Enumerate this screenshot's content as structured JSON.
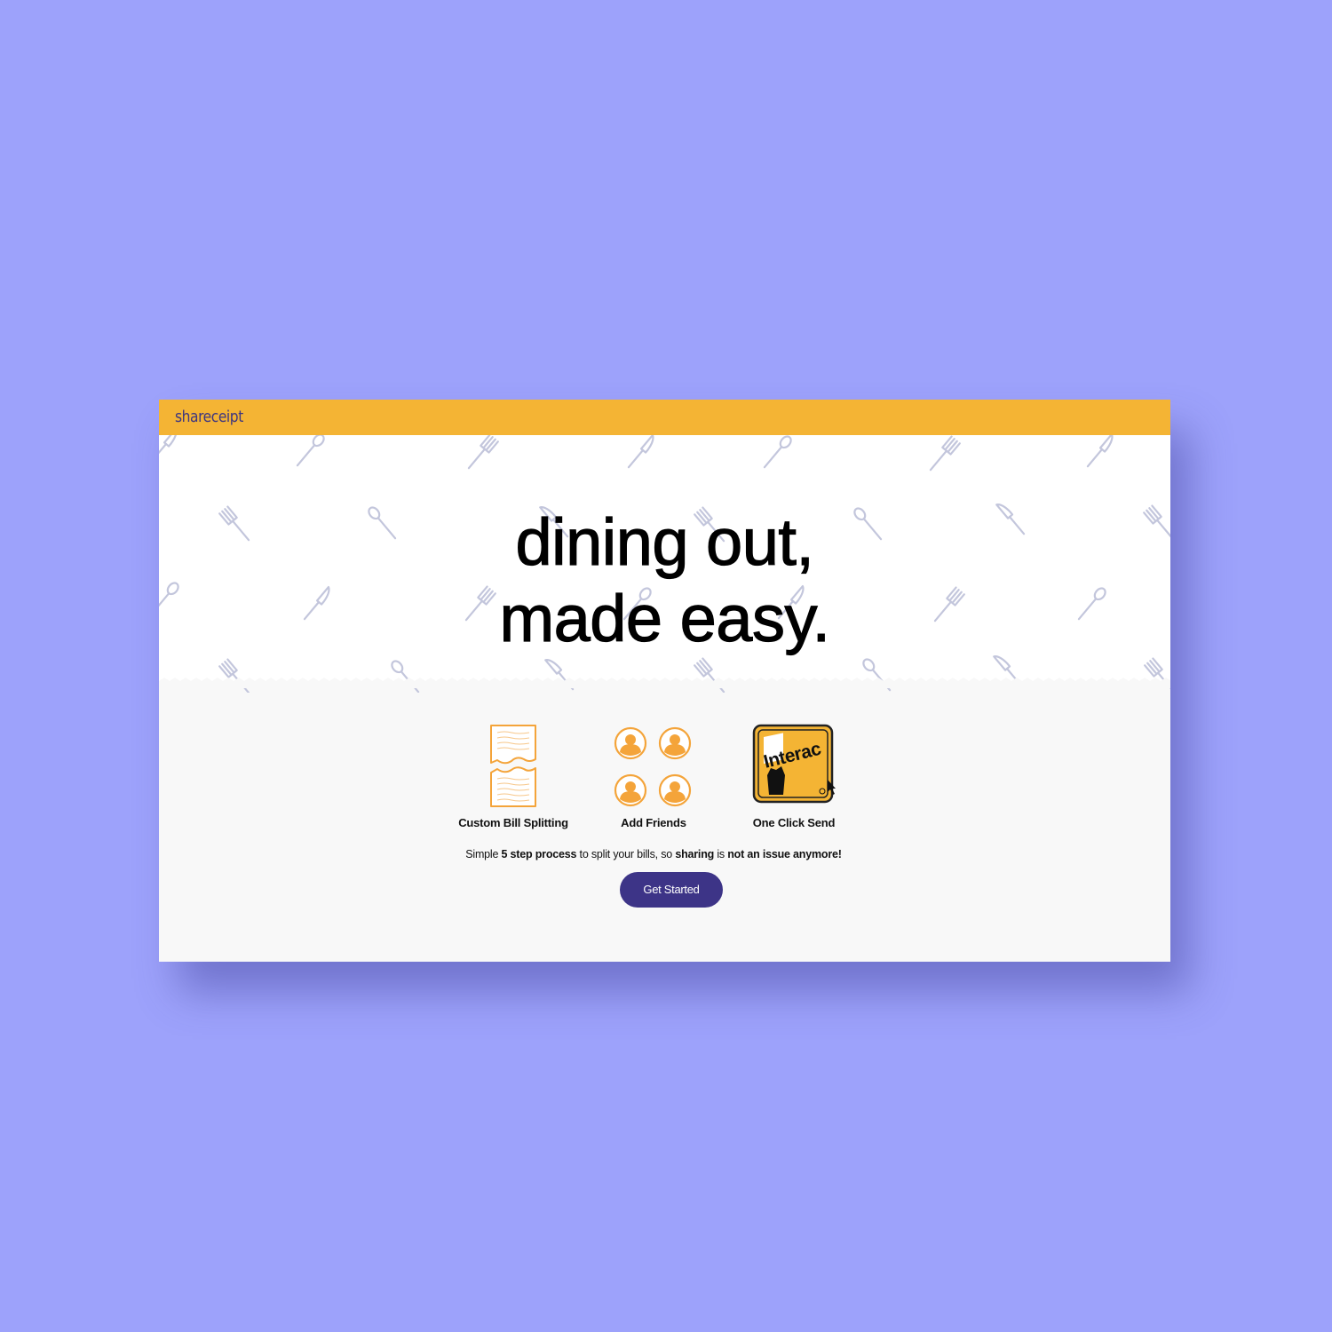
{
  "app": {
    "brand": "shareceipt",
    "colors": {
      "background": "#9da2fb",
      "header": "#f4b434",
      "accent": "#3d3487",
      "utensil": "#c3c6dc",
      "icon_orange": "#f4a43a"
    }
  },
  "hero": {
    "headline_line1": "dining out,",
    "headline_line2": "made easy.",
    "background_pattern": [
      "fork-icon",
      "knife-icon",
      "spoon-icon"
    ]
  },
  "features": [
    {
      "label": "Custom Bill Splitting",
      "icon": "torn-receipt-icon"
    },
    {
      "label": "Add Friends",
      "icon": "friends-icon"
    },
    {
      "label": "One Click Send",
      "icon": "interac-logo",
      "logo_text": "Interac"
    }
  ],
  "tagline": {
    "part1": "Simple ",
    "bold1": "5 step process",
    "part2": " to split your bills, so ",
    "bold2": "sharing",
    "part3": " is ",
    "bold3": "not an issue anymore!"
  },
  "cta": {
    "label": "Get Started"
  }
}
